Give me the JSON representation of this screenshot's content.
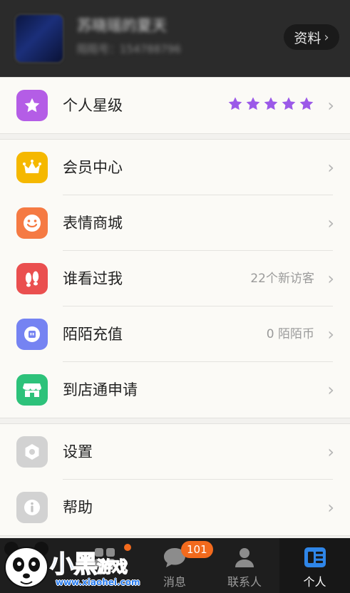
{
  "header": {
    "username": "苏晓瑶的夏天",
    "momo_id": "陌陌号：154788796",
    "profile_button": "资料"
  },
  "sections": [
    {
      "rows": [
        {
          "label": "个人星级",
          "icon": "star-icon",
          "color": "#b45de6",
          "stars": 5
        }
      ]
    },
    {
      "rows": [
        {
          "label": "会员中心",
          "icon": "crown-icon",
          "color": "#f5b800",
          "value": ""
        },
        {
          "label": "表情商城",
          "icon": "smiley-icon",
          "color": "#f57a43",
          "value": ""
        },
        {
          "label": "谁看过我",
          "icon": "footprint-icon",
          "color": "#ea4f4f",
          "value": "22个新访客"
        },
        {
          "label": "陌陌充值",
          "icon": "coin-icon",
          "color": "#7583f2",
          "value": "0 陌陌币"
        },
        {
          "label": "到店通申请",
          "icon": "store-icon",
          "color": "#2dc27a",
          "value": ""
        }
      ]
    },
    {
      "rows": [
        {
          "label": "设置",
          "icon": "settings-icon",
          "color": "#d2d2d2",
          "value": ""
        },
        {
          "label": "帮助",
          "icon": "info-icon",
          "color": "#d2d2d2",
          "value": ""
        }
      ]
    }
  ],
  "tabs": [
    {
      "label": "",
      "icon": "nearby-icon",
      "dot": true
    },
    {
      "label": "消息",
      "icon": "message-icon",
      "badge": "101"
    },
    {
      "label": "联系人",
      "icon": "contacts-icon"
    },
    {
      "label": "个人",
      "icon": "profile-icon",
      "active": true
    }
  ],
  "watermark": {
    "title": "小黑",
    "title_small": "游戏",
    "url": "www.xiaohei.com"
  },
  "colors": {
    "header_bg": "#2b2b2b",
    "star": "#9b59e8",
    "accent_badge": "#f26a1d",
    "active_tab_icon": "#2f86e8"
  }
}
